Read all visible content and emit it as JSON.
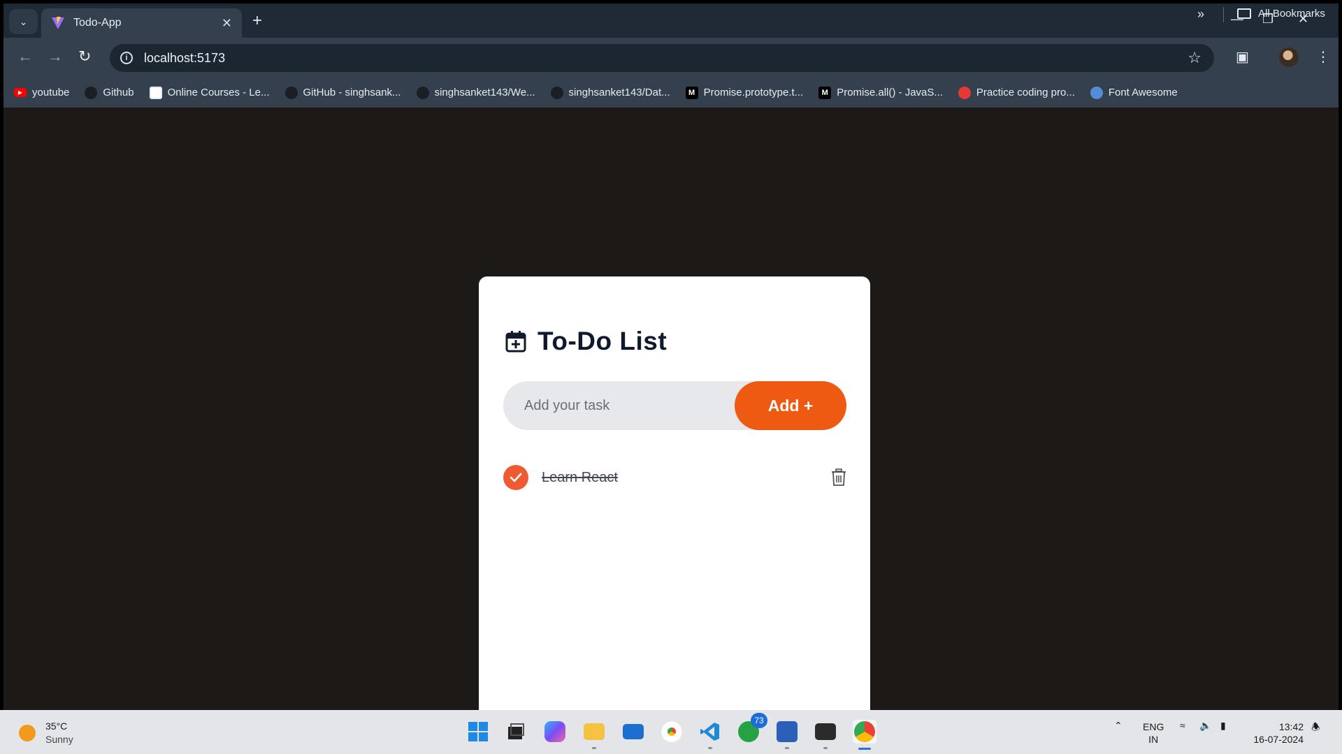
{
  "browser": {
    "tab_title": "Todo-App",
    "url": "localhost:5173",
    "bookmarks": [
      {
        "label": "youtube",
        "icon": "youtube-icon",
        "color": "#ff0000"
      },
      {
        "label": "Github",
        "icon": "github-icon",
        "color": "#1b1f23"
      },
      {
        "label": "Online Courses - Le...",
        "icon": "course-icon",
        "color": "#ffffff"
      },
      {
        "label": "GitHub - singhsank...",
        "icon": "github-icon",
        "color": "#1b1f23"
      },
      {
        "label": "singhsanket143/We...",
        "icon": "github-icon",
        "color": "#1b1f23"
      },
      {
        "label": "singhsanket143/Dat...",
        "icon": "github-icon",
        "color": "#1b1f23"
      },
      {
        "label": "Promise.prototype.t...",
        "icon": "mdn-icon",
        "color": "#000000"
      },
      {
        "label": "Promise.all() - JavaS...",
        "icon": "mdn-icon",
        "color": "#000000"
      },
      {
        "label": "Practice coding pro...",
        "icon": "codechef-icon",
        "color": "#e53935"
      },
      {
        "label": "Font Awesome",
        "icon": "font-awesome-icon",
        "color": "#538dd7"
      }
    ],
    "all_bookmarks_label": "All Bookmarks"
  },
  "app": {
    "title": "To-Do List",
    "input_placeholder": "Add your task",
    "input_value": "",
    "add_button_label": "Add +",
    "accent_color": "#ef5a12",
    "todos": [
      {
        "text": "Learn React",
        "completed": true
      }
    ]
  },
  "taskbar": {
    "temperature": "35°C",
    "condition": "Sunny",
    "whatsapp_badge": "73",
    "language_line1": "ENG",
    "language_line2": "IN",
    "time": "13:42",
    "date": "16-07-2024"
  }
}
